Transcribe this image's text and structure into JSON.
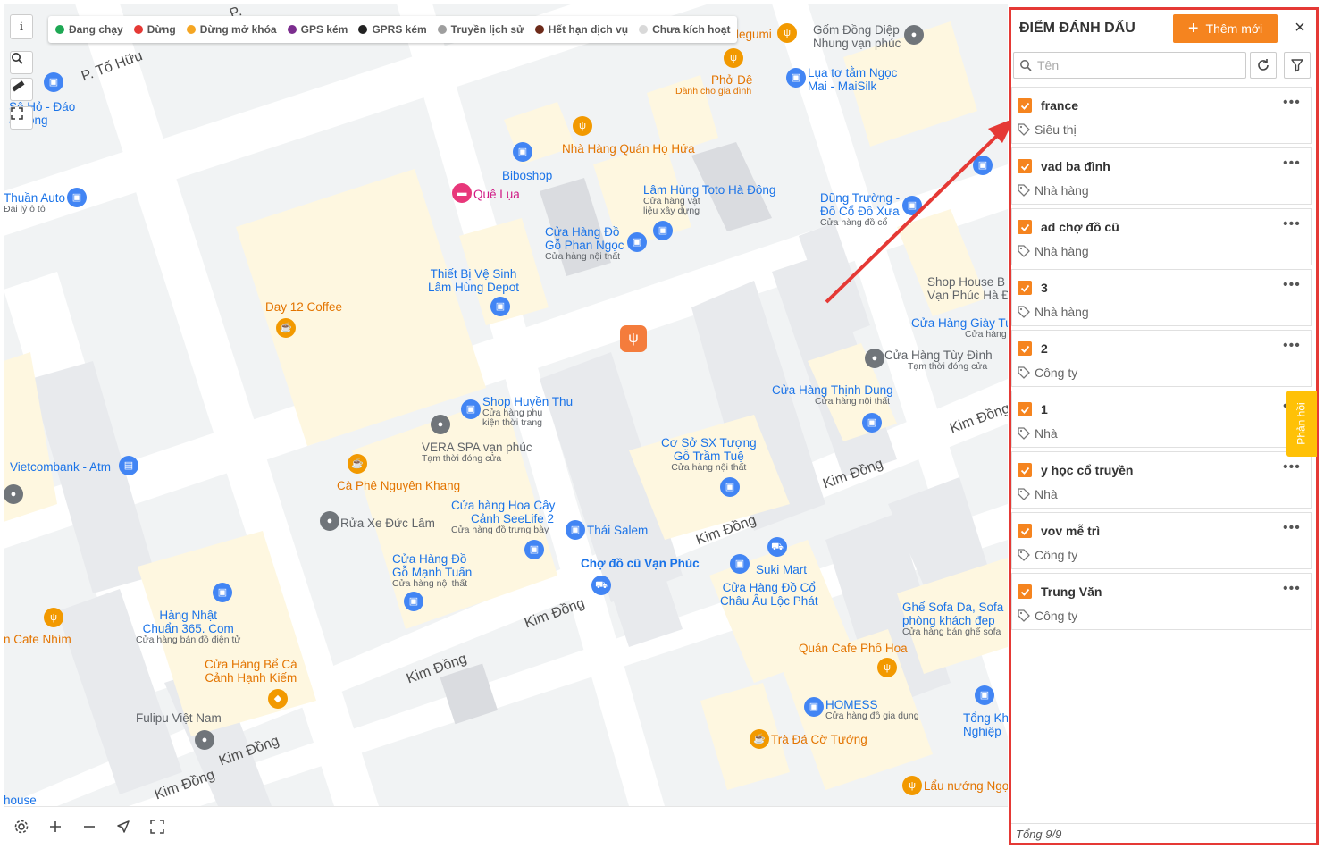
{
  "legend": [
    {
      "label": "Đang chạy",
      "color": "#1ea854"
    },
    {
      "label": "Dừng",
      "color": "#e53935"
    },
    {
      "label": "Dừng mở khóa",
      "color": "#f5a623"
    },
    {
      "label": "GPS kém",
      "color": "#7b2d8e"
    },
    {
      "label": "GPRS kém",
      "color": "#222222"
    },
    {
      "label": "Truyền lịch sử",
      "color": "#9e9e9e"
    },
    {
      "label": "Hết hạn dịch vụ",
      "color": "#6d2b1a"
    },
    {
      "label": "Chưa kích hoạt",
      "color": "#d9d9d9"
    }
  ],
  "map_controls": {
    "info_label": "i"
  },
  "map_labels": {
    "to_huu": "P. Tố Hữu",
    "to_huu_short": "P.",
    "kim_dong": "Kim Đồng",
    "dao_ha_dong_1": "Sô Hỏ - Đáo",
    "dao_ha_dong_2": "à Đông",
    "thuan_auto": "Thuần Auto",
    "thuan_auto_sub": "Đại lý ô tô",
    "megumi": "hàng Megumi",
    "pho_de": "Phở Dê",
    "pho_de_sub": "Dành cho gia đình",
    "gom_dong_diep_1": "Gốm Đồng Diệp",
    "gom_dong_diep_2": "Nhung vạn phúc",
    "lua_to_tam_1": "Lụa tơ tằm Ngọc",
    "lua_to_tam_2": "Mai - MaiSilk",
    "quan_ho_hua": "Nhà Hàng Quán Họ Hứa",
    "biboshop": "Biboshop",
    "que_lua": "Quê Lụa",
    "lam_hung_toto": "Lâm Hùng Toto Hà Đông",
    "lam_hung_toto_sub1": "Cửa hàng vật",
    "lam_hung_toto_sub2": "liệu xây dựng",
    "dung_truong_1": "Dũng Trường -",
    "dung_truong_2": "Đồ Cổ Đồ Xưa",
    "dung_truong_sub": "Cửa hàng đồ cổ",
    "go_phan_ngoc_1": "Cửa Hàng Đồ",
    "go_phan_ngoc_2": "Gỗ Phan Ngọc",
    "go_phan_ngoc_sub": "Cửa hàng nội thất",
    "thiet_bi_1": "Thiết Bị Vệ Sinh",
    "thiet_bi_2": "Lâm Hùng Depot",
    "day12": "Day 12 Coffee",
    "shop_house_1": "Shop House B",
    "shop_house_2": "Vạn Phúc Hà Đ",
    "giay_tu": "Cửa Hàng Giày Tu",
    "giay_tu_sub": "Cửa hàng",
    "tuy_dinh": "Cửa Hàng Tùy Đình",
    "tuy_dinh_sub": "Tạm thời đóng cửa",
    "thinh_dung": "Cửa Hàng Thịnh Dung",
    "thinh_dung_sub": "Cửa hàng nội thất",
    "huyen_thu": "Shop Huyền Thu",
    "huyen_thu_sub1": "Cửa hàng phụ",
    "huyen_thu_sub2": "kiện thời trang",
    "vera_spa": "VERA SPA vạn phúc",
    "vera_spa_sub": "Tạm thời đóng cửa",
    "vietcombank": "Vietcombank - Atm",
    "tram_tue_1": "Cơ Sở SX Tượng",
    "tram_tue_2": "Gỗ Trầm Tuệ",
    "tram_tue_sub": "Cửa hàng nội thất",
    "nguyen_khang": "Cà Phê Nguyên Khang",
    "hoa_cay_1": "Cửa hàng Hoa Cây",
    "hoa_cay_2": "Cảnh SeeLife 2",
    "hoa_cay_sub": "Cửa hàng đồ trưng bày",
    "rua_xe": "Rửa Xe Đức Lâm",
    "thai_salem": "Thái Salem",
    "manh_tuan_1": "Cửa Hàng Đồ",
    "manh_tuan_2": "Gỗ Mạnh Tuấn",
    "manh_tuan_sub": "Cửa hàng nội thất",
    "cho_do_cu": "Chợ đồ cũ Vạn Phúc",
    "suki_mart": "Suki Mart",
    "chau_au_1": "Cửa Hàng Đồ Cổ",
    "chau_au_2": "Châu Âu Lộc Phát",
    "sofa_1": "Ghế Sofa Da, Sofa",
    "sofa_2": "phòng khách đẹp",
    "sofa_sub": "Cửa hàng bán ghế sofa",
    "hang_nhat_1": "Hàng Nhật",
    "hang_nhat_2": "Chuẩn 365. Com",
    "hang_nhat_sub": "Cửa hàng bán đồ điện tử",
    "cafe_nhim": "n Cafe Nhím",
    "be_ca_1": "Cửa Hàng Bể Cá",
    "be_ca_2": "Cảnh Hạnh Kiếm",
    "pho_hoa": "Quán Cafe Phố Hoa",
    "homess": "HOMESS",
    "homess_sub": "Cửa hàng đồ gia dụng",
    "tong_kho_1": "Tổng Kh",
    "tong_kho_2": "Nghiệp",
    "fulipu": "Fulipu Việt Nam",
    "tra_da": "Trà Đá Cờ Tướng",
    "lau_nuong": "Lẩu nướng Ngọ",
    "house": "house"
  },
  "panel": {
    "title": "ĐIỂM ĐÁNH DẤU",
    "add_label": "Thêm mới",
    "close_label": "×",
    "search_placeholder": "Tên",
    "total_label": "Tổng 9/9"
  },
  "markers": [
    {
      "name": "france",
      "category": "Siêu thị",
      "checked": true
    },
    {
      "name": "vad ba đình",
      "category": "Nhà hàng",
      "checked": true
    },
    {
      "name": "ad chợ đồ cũ",
      "category": "Nhà hàng",
      "checked": true
    },
    {
      "name": "3",
      "category": "Nhà hàng",
      "checked": true
    },
    {
      "name": "2",
      "category": "Công ty",
      "checked": true
    },
    {
      "name": "1",
      "category": "Nhà",
      "checked": true
    },
    {
      "name": "y học cổ truyền",
      "category": "Nhà",
      "checked": true
    },
    {
      "name": "vov mễ trì",
      "category": "Công ty",
      "checked": true
    },
    {
      "name": "Trung Văn",
      "category": "Công ty",
      "checked": true
    }
  ],
  "feedback": {
    "label": "Phản hồi"
  },
  "colors": {
    "accent": "#f5841f",
    "highlight_border": "#e53935",
    "feedback": "#ffc107"
  }
}
